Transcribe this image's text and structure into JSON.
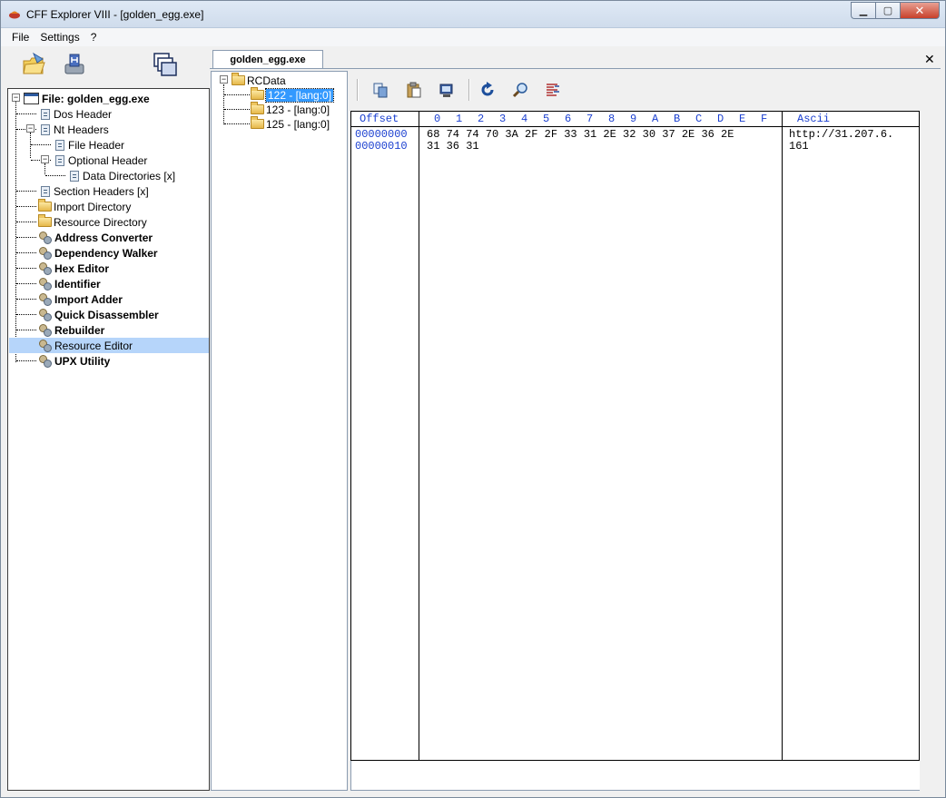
{
  "window": {
    "title": "CFF Explorer VIII - [golden_egg.exe]",
    "controls": {
      "minimize": "▁",
      "maximize": "▢",
      "close": "✕"
    }
  },
  "menu": [
    "File",
    "Settings",
    "?"
  ],
  "toolbar_icons": [
    "open-icon",
    "save-icon",
    "windows-icon"
  ],
  "tree": {
    "root": "File: golden_egg.exe",
    "items": [
      {
        "label": "Dos Header",
        "icon": "document-icon"
      },
      {
        "label": "Nt Headers",
        "icon": "document-icon"
      },
      {
        "label": "File Header",
        "icon": "document-icon"
      },
      {
        "label": "Optional Header",
        "icon": "document-icon"
      },
      {
        "label": "Data Directories [x]",
        "icon": "document-icon"
      },
      {
        "label": "Section Headers [x]",
        "icon": "document-icon"
      },
      {
        "label": "Import Directory",
        "icon": "folder-icon"
      },
      {
        "label": "Resource Directory",
        "icon": "folder-icon"
      },
      {
        "label": "Address Converter",
        "icon": "gears-icon"
      },
      {
        "label": "Dependency Walker",
        "icon": "gears-icon"
      },
      {
        "label": "Hex Editor",
        "icon": "gears-icon"
      },
      {
        "label": "Identifier",
        "icon": "gears-icon"
      },
      {
        "label": "Import Adder",
        "icon": "gears-icon"
      },
      {
        "label": "Quick Disassembler",
        "icon": "gears-icon"
      },
      {
        "label": "Rebuilder",
        "icon": "gears-icon"
      },
      {
        "label": "Resource Editor",
        "icon": "gears-icon",
        "selected": true
      },
      {
        "label": "UPX Utility",
        "icon": "gears-icon"
      }
    ]
  },
  "tab": {
    "label": "golden_egg.exe",
    "close": "✕"
  },
  "resources": {
    "root": "RCData",
    "items": [
      "122 - [lang:0]",
      "123 - [lang:0]",
      "125 - [lang:0]"
    ],
    "selected": "122 - [lang:0]"
  },
  "hex_toolbar": [
    "copy-icon",
    "paste-icon",
    "replace-icon",
    "refresh-icon",
    "search-icon",
    "hex-view-icon"
  ],
  "hex": {
    "offset_header": "Offset",
    "columns": [
      "0",
      "1",
      "2",
      "3",
      "4",
      "5",
      "6",
      "7",
      "8",
      "9",
      "A",
      "B",
      "C",
      "D",
      "E",
      "F"
    ],
    "ascii_header": "Ascii",
    "rows": [
      {
        "offset": "00000000",
        "bytes": "68 74 74 70 3A 2F 2F 33 31 2E 32 30 37 2E 36 2E",
        "ascii": "http://31.207.6."
      },
      {
        "offset": "00000010",
        "bytes": "31 36 31",
        "ascii": "161"
      }
    ]
  }
}
